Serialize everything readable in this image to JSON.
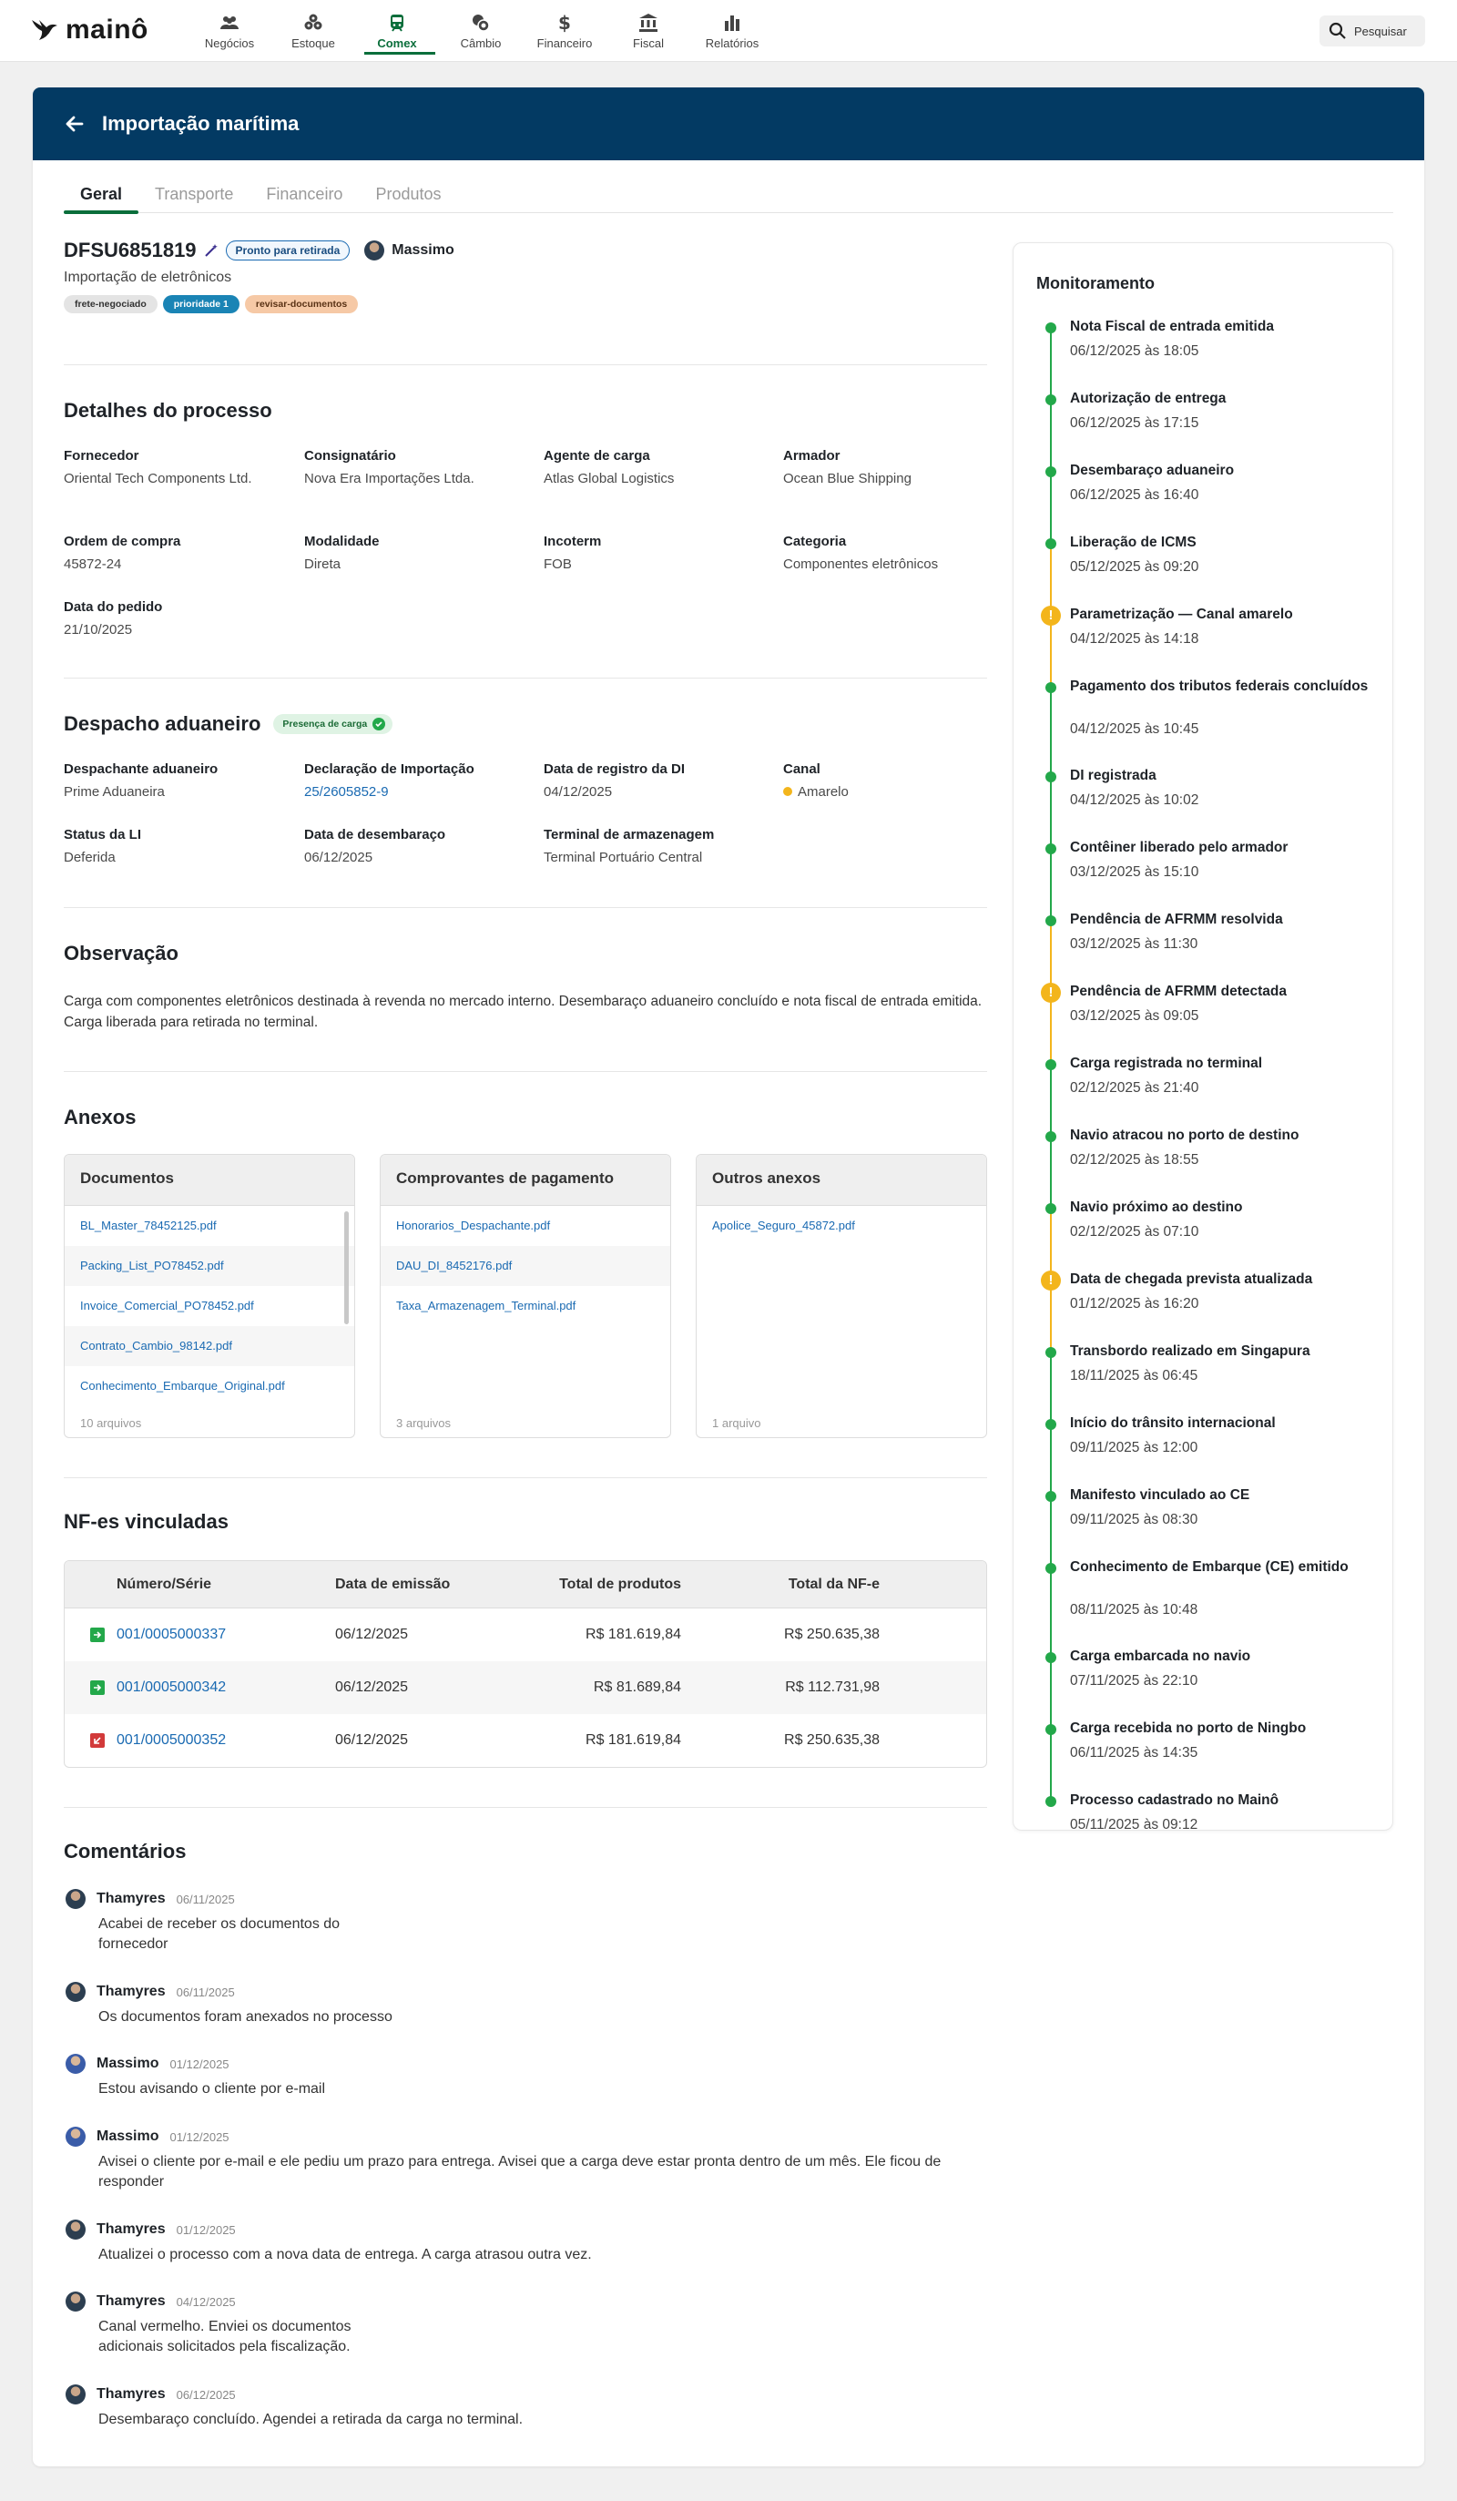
{
  "app": {
    "logo": "mainô",
    "search_label": "Pesquisar"
  },
  "nav": [
    {
      "label": "Negócios",
      "icon": "users-icon"
    },
    {
      "label": "Estoque",
      "icon": "boxes-icon"
    },
    {
      "label": "Comex",
      "icon": "train-icon",
      "active": true
    },
    {
      "label": "Câmbio",
      "icon": "coins-icon"
    },
    {
      "label": "Financeiro",
      "icon": "dollar-icon"
    },
    {
      "label": "Fiscal",
      "icon": "bank-icon"
    },
    {
      "label": "Relatórios",
      "icon": "bar-chart-icon"
    }
  ],
  "header": {
    "title": "Importação marítima"
  },
  "tabs": [
    "Geral",
    "Transporte",
    "Financeiro",
    "Produtos"
  ],
  "process": {
    "code": "DFSU6851819",
    "status": "Pronto para retirada",
    "owner": "Massimo",
    "description": "Importação de eletrônicos",
    "tags": [
      {
        "label": "frete-negociado",
        "bg": "#e4e4e4",
        "fg": "#333333"
      },
      {
        "label": "prioridade 1",
        "bg": "#1a84b5",
        "fg": "#ffffff"
      },
      {
        "label": "revisar-documentos",
        "bg": "#f6c9a6",
        "fg": "#5a3215"
      }
    ]
  },
  "details": {
    "title": "Detalhes do processo",
    "fields": [
      {
        "label": "Fornecedor",
        "value": "Oriental Tech Components Ltd."
      },
      {
        "label": "Consignatário",
        "value": "Nova Era Importações Ltda."
      },
      {
        "label": "Agente de carga",
        "value": "Atlas Global Logistics"
      },
      {
        "label": "Armador",
        "value": "Ocean Blue Shipping"
      },
      {
        "label": "Ordem de compra",
        "value": "45872-24"
      },
      {
        "label": "Modalidade",
        "value": "Direta"
      },
      {
        "label": "Incoterm",
        "value": "FOB"
      },
      {
        "label": "Categoria",
        "value": "Componentes eletrônicos"
      },
      {
        "label": "Data do pedido",
        "value": "21/10/2025"
      }
    ]
  },
  "customs": {
    "title": "Despacho aduaneiro",
    "badge": "Presença de carga",
    "fields": [
      {
        "label": "Despachante aduaneiro",
        "value": "Prime Aduaneira"
      },
      {
        "label": "Declaração de Importação",
        "value": "25/2605852-9"
      },
      {
        "label": "Data de registro da DI",
        "value": "04/12/2025"
      },
      {
        "label": "Canal",
        "value": "Amarelo"
      },
      {
        "label": "Status da LI",
        "value": "Deferida"
      },
      {
        "label": "Data de desembaraço",
        "value": "06/12/2025"
      },
      {
        "label": "Terminal de armazenagem",
        "value": "Terminal Portuário Central"
      }
    ]
  },
  "observation": {
    "title": "Observação",
    "text": "Carga com componentes eletrônicos destinada à revenda no mercado interno. Desembaraço aduaneiro concluído e nota fiscal de entrada emitida. Carga liberada para retirada no terminal."
  },
  "attachments": {
    "title": "Anexos",
    "groups": [
      {
        "title": "Documentos",
        "files": [
          "BL_Master_78452125.pdf",
          "Packing_List_PO78452.pdf",
          "Invoice_Comercial_PO78452.pdf",
          "Contrato_Cambio_98142.pdf",
          "Conhecimento_Embarque_Original.pdf"
        ],
        "count": "10 arquivos"
      },
      {
        "title": "Comprovantes de pagamento",
        "files": [
          "Honorarios_Despachante.pdf",
          "DAU_DI_8452176.pdf",
          "Taxa_Armazenagem_Terminal.pdf"
        ],
        "count": "3 arquivos"
      },
      {
        "title": "Outros anexos",
        "files": [
          "Apolice_Seguro_45872.pdf"
        ],
        "count": "1 arquivo"
      }
    ]
  },
  "nfes": {
    "title": "NF-es vinculadas",
    "columns": [
      "Número/Série",
      "Data de emissão",
      "Total de produtos",
      "Total da NF-e"
    ],
    "rows": [
      {
        "status": "entrada",
        "number": "001/0005000337",
        "date": "06/12/2025",
        "products": "R$ 181.619,84",
        "total": "R$ 250.635,38"
      },
      {
        "status": "entrada",
        "number": "001/0005000342",
        "date": "06/12/2025",
        "products": "R$ 81.689,84",
        "total": "R$ 112.731,98"
      },
      {
        "status": "cancelada",
        "number": "001/0005000352",
        "date": "06/12/2025",
        "products": "R$ 181.619,84",
        "total": "R$ 250.635,38"
      }
    ]
  },
  "comments": {
    "title": "Comentários",
    "items": [
      {
        "author": "Thamyres",
        "date": "06/11/2025",
        "text": "Acabei de receber os documentos do fornecedor"
      },
      {
        "author": "Thamyres",
        "date": "06/11/2025",
        "text": "Os documentos foram anexados no processo"
      },
      {
        "author": "Massimo",
        "date": "01/12/2025",
        "text": "Estou avisando o cliente por e-mail"
      },
      {
        "author": "Massimo",
        "date": "01/12/2025",
        "text": "Avisei o cliente por e-mail e ele pediu um prazo para entrega. Avisei que a carga deve estar pronta dentro de um mês. Ele ficou de responder"
      },
      {
        "author": "Thamyres",
        "date": "01/12/2025",
        "text": "Atualizei o processo com a nova data de entrega. A carga atrasou outra vez."
      },
      {
        "author": "Thamyres",
        "date": "04/12/2025",
        "text": "Canal vermelho. Enviei os documentos adicionais solicitados pela fiscalização."
      },
      {
        "author": "Thamyres",
        "date": "06/12/2025",
        "text": "Desembaraço concluído. Agendei a retirada da carga no terminal."
      }
    ]
  },
  "monitoring": {
    "title": "Monitoramento",
    "events": [
      {
        "title": "Nota Fiscal de entrada emitida",
        "date": "06/12/2025 às 18:05",
        "type": "ok"
      },
      {
        "title": "Autorização de entrega",
        "date": "06/12/2025 às 17:15",
        "type": "ok"
      },
      {
        "title": "Desembaraço aduaneiro",
        "date": "06/12/2025 às 16:40",
        "type": "ok"
      },
      {
        "title": "Liberação de ICMS",
        "date": "05/12/2025 às 09:20",
        "type": "ok"
      },
      {
        "title": "Parametrização — Canal amarelo",
        "date": "04/12/2025 às 14:18",
        "type": "warn"
      },
      {
        "title": "Pagamento dos tributos federais concluídos",
        "date": "04/12/2025 às 10:45",
        "type": "ok"
      },
      {
        "title": "DI registrada",
        "date": "04/12/2025 às 10:02",
        "type": "ok"
      },
      {
        "title": "Contêiner liberado pelo armador",
        "date": "03/12/2025 às 15:10",
        "type": "ok"
      },
      {
        "title": "Pendência de AFRMM resolvida",
        "date": "03/12/2025 às 11:30",
        "type": "ok"
      },
      {
        "title": "Pendência de AFRMM detectada",
        "date": "03/12/2025 às 09:05",
        "type": "warn"
      },
      {
        "title": "Carga registrada no terminal",
        "date": "02/12/2025 às 21:40",
        "type": "ok"
      },
      {
        "title": "Navio atracou no porto de destino",
        "date": "02/12/2025 às 18:55",
        "type": "ok"
      },
      {
        "title": "Navio próximo ao destino",
        "date": "02/12/2025 às 07:10",
        "type": "ok"
      },
      {
        "title": "Data de chegada prevista atualizada",
        "date": "01/12/2025 às 16:20",
        "type": "warn"
      },
      {
        "title": "Transbordo realizado em Singapura",
        "date": "18/11/2025 às 06:45",
        "type": "ok"
      },
      {
        "title": "Início do trânsito internacional",
        "date": "09/11/2025 às 12:00",
        "type": "ok"
      },
      {
        "title": "Manifesto vinculado ao CE",
        "date": "09/11/2025 às 08:30",
        "type": "ok"
      },
      {
        "title": "Conhecimento de Embarque (CE) emitido",
        "date": "08/11/2025 às 10:48",
        "type": "ok"
      },
      {
        "title": "Carga embarcada no navio",
        "date": "07/11/2025 às 22:10",
        "type": "ok"
      },
      {
        "title": "Carga recebida no porto de Ningbo",
        "date": "06/11/2025 às 14:35",
        "type": "ok"
      },
      {
        "title": "Processo cadastrado no Mainô",
        "date": "05/11/2025 às 09:12",
        "type": "ok"
      }
    ]
  },
  "colors": {
    "brand": "#033a63",
    "accent": "#0a6e3b",
    "ok": "#23a84a",
    "warn": "#f3b51c",
    "link": "#1a6ab2"
  }
}
